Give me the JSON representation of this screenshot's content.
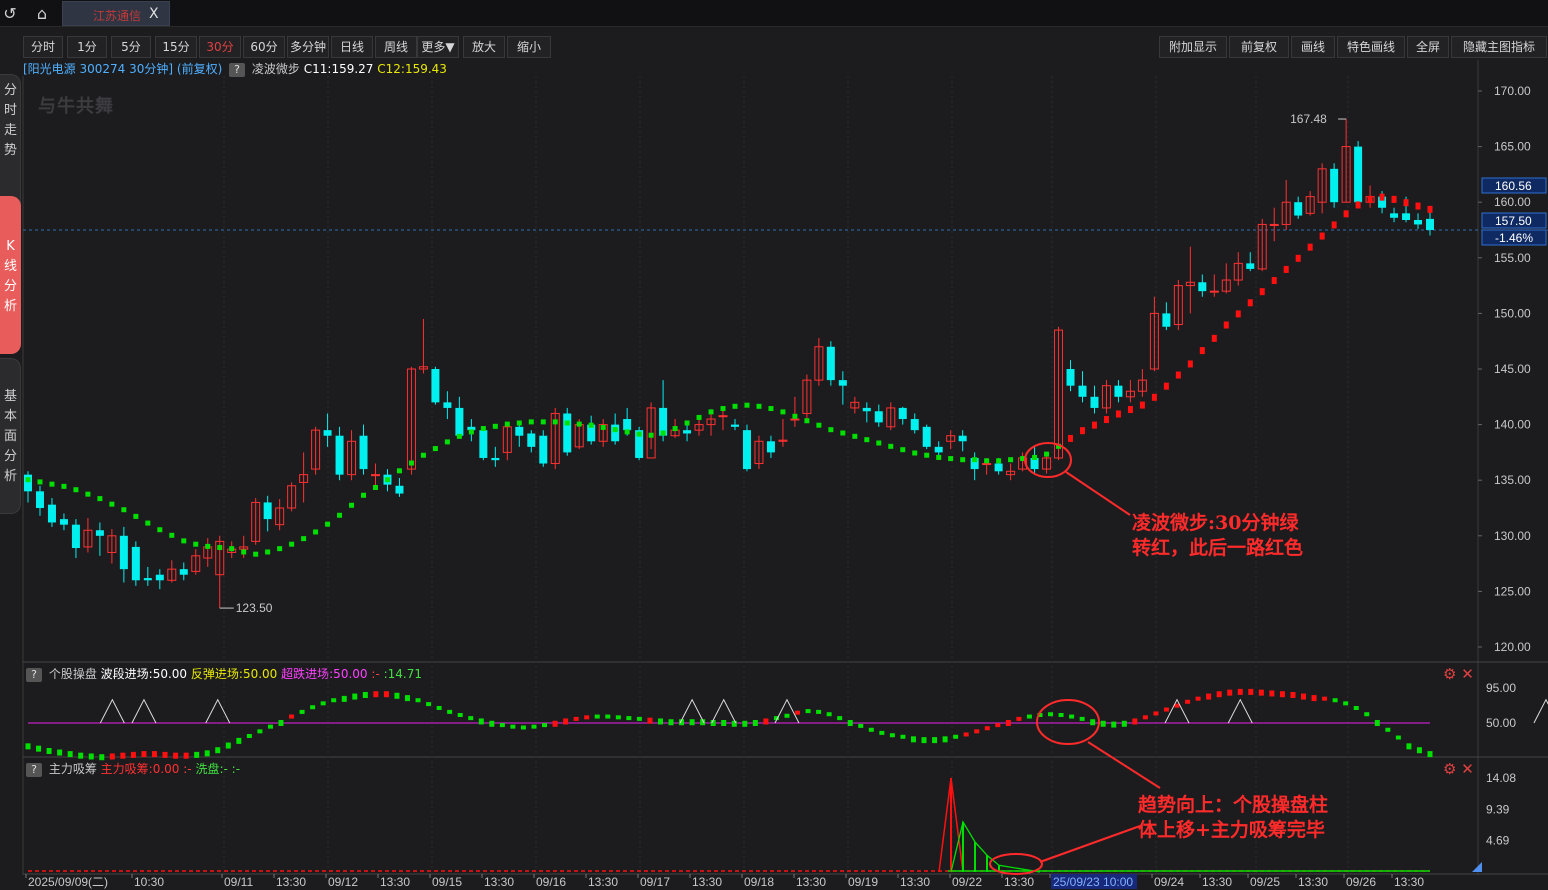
{
  "window": {
    "tab_title": "江苏通信",
    "close_glyph": "X",
    "icons": [
      "back-icon",
      "home-icon"
    ]
  },
  "side_tabs": [
    {
      "label": [
        "分",
        "时",
        "走",
        "势"
      ],
      "active": false
    },
    {
      "label": [
        "K",
        "线",
        "分",
        "析"
      ],
      "active": true
    },
    {
      "label": [
        "基",
        "本",
        "面",
        "分",
        "析"
      ],
      "active": false
    }
  ],
  "toolbar": {
    "left": [
      "分时",
      "1分",
      "5分",
      "15分",
      "30分",
      "60分",
      "多分钟",
      "日线",
      "周线",
      "更多▼",
      "放大",
      "缩小"
    ],
    "active": "30分",
    "right": [
      "附加显示",
      "前复权",
      "画线",
      "特色画线",
      "全屏",
      "隐藏主图指标"
    ]
  },
  "title_line": {
    "stock": "[阳光电源 300274 30分钟] (前复权)",
    "indicator": "凌波微步",
    "c11": "C11:159.27",
    "c12": "C12:159.43",
    "help": "?"
  },
  "watermark": "与牛共舞",
  "main_axis": {
    "ticks": [
      "170.00",
      "165.00",
      "160.00",
      "155.00",
      "150.00",
      "145.00",
      "140.00",
      "135.00",
      "130.00",
      "125.00",
      "120.00"
    ],
    "tag_upper": "160.56",
    "tag_price": "157.50",
    "tag_change": "-1.46%",
    "high_label": "167.48",
    "low_label": "123.50"
  },
  "annotations": {
    "a1_line1": "凌波微步:30分钟绿",
    "a1_line2": "转红，此后一路红色",
    "a2_line1": "趋势向上：个股操盘柱",
    "a2_line2": "体上移+主力吸筹完毕"
  },
  "ind1": {
    "name": "个股操盘",
    "p1": "波段进场:50.00",
    "p2": "反弹进场:50.00",
    "p3": "超跌进场:50.00",
    "p4": ":-",
    "p5": ":14.71",
    "ticks": [
      "95.00",
      "50.00"
    ],
    "help": "?"
  },
  "ind2": {
    "name": "主力吸筹",
    "p1": "主力吸筹:0.00",
    "p2": ":-",
    "p3": "洗盘:-",
    "p4": ":-",
    "ticks": [
      "14.08",
      "9.39",
      "4.69"
    ],
    "help": "?"
  },
  "x_axis": [
    "2025/09/09(二)",
    "10:30",
    "09/11",
    "13:30",
    "09/12",
    "13:30",
    "09/15",
    "13:30",
    "09/16",
    "13:30",
    "09/17",
    "13:30",
    "09/18",
    "13:30",
    "09/19",
    "13:30",
    "09/22",
    "13:30",
    "25/09/23 10:00",
    "09/24",
    "13:30",
    "09/25",
    "13:30",
    "09/26",
    "13:30"
  ],
  "colors": {
    "up": "#ff3030",
    "down": "#00f0f0",
    "dot_green": "#00e000",
    "dot_red": "#ff1010",
    "purple": "#c020c0",
    "annot": "#ff2a2a"
  },
  "chart_data": {
    "type": "candlestick",
    "price_ylim": [
      120,
      170
    ],
    "candles": [
      [
        135.5,
        134.0,
        135.8,
        133.0
      ],
      [
        134.0,
        132.5,
        134.5,
        131.8
      ],
      [
        132.8,
        131.2,
        133.4,
        130.8
      ],
      [
        131.5,
        131.0,
        132.0,
        130.5
      ],
      [
        131.0,
        128.9,
        131.5,
        128.0
      ],
      [
        129.0,
        130.5,
        131.6,
        128.5
      ],
      [
        130.5,
        130.0,
        131.2,
        128.2
      ],
      [
        128.5,
        130.0,
        130.6,
        127.5
      ],
      [
        130.0,
        127.0,
        130.8,
        125.8
      ],
      [
        129.0,
        126.0,
        129.5,
        125.5
      ],
      [
        126.2,
        126.0,
        127.2,
        125.5
      ],
      [
        126.5,
        126.0,
        127.0,
        125.2
      ],
      [
        126.0,
        127.0,
        127.8,
        125.8
      ],
      [
        127.0,
        126.5,
        127.6,
        126.0
      ],
      [
        126.8,
        128.2,
        128.8,
        126.5
      ],
      [
        128.0,
        129.0,
        129.8,
        127.2
      ],
      [
        126.5,
        129.5,
        130.0,
        123.5
      ],
      [
        128.5,
        128.8,
        129.5,
        128.0
      ],
      [
        128.8,
        129.0,
        130.0,
        128.0
      ],
      [
        129.5,
        133.0,
        133.4,
        129.2
      ],
      [
        133.0,
        131.5,
        133.6,
        130.4
      ],
      [
        131.0,
        132.5,
        133.3,
        130.5
      ],
      [
        132.5,
        134.5,
        134.8,
        132.2
      ],
      [
        134.8,
        135.5,
        137.5,
        133.0
      ],
      [
        136.0,
        139.5,
        139.8,
        135.5
      ],
      [
        139.5,
        139.0,
        141.0,
        138.0
      ],
      [
        139.0,
        135.5,
        139.8,
        135.0
      ],
      [
        135.5,
        138.5,
        139.5,
        135.0
      ],
      [
        139.0,
        136.0,
        140.0,
        135.5
      ],
      [
        135.5,
        135.5,
        136.5,
        134.5
      ],
      [
        135.5,
        134.6,
        136.0,
        134.0
      ],
      [
        134.5,
        133.8,
        135.2,
        133.5
      ],
      [
        136.0,
        145.0,
        145.2,
        135.5
      ],
      [
        145.0,
        145.2,
        149.5,
        144.6
      ],
      [
        145.0,
        142.0,
        145.2,
        141.8
      ],
      [
        142.0,
        141.5,
        143.0,
        140.5
      ],
      [
        141.5,
        139.0,
        142.5,
        138.8
      ],
      [
        139.8,
        139.5,
        140.5,
        138.5
      ],
      [
        139.5,
        137.0,
        139.8,
        136.8
      ],
      [
        137.0,
        136.8,
        138.0,
        136.2
      ],
      [
        137.5,
        139.8,
        140.0,
        136.8
      ],
      [
        139.8,
        139.0,
        140.2,
        138.0
      ],
      [
        139.2,
        138.0,
        139.5,
        137.5
      ],
      [
        139.0,
        136.5,
        139.5,
        136.2
      ],
      [
        136.5,
        141.0,
        141.5,
        136.0
      ],
      [
        141.0,
        137.5,
        141.5,
        137.2
      ],
      [
        138.0,
        140.0,
        140.5,
        137.8
      ],
      [
        140.0,
        138.5,
        140.8,
        138.2
      ],
      [
        138.5,
        140.0,
        140.5,
        138.0
      ],
      [
        140.0,
        138.5,
        141.0,
        138.2
      ],
      [
        140.5,
        139.5,
        141.5,
        139.0
      ],
      [
        139.5,
        137.0,
        139.8,
        136.8
      ],
      [
        137.0,
        141.5,
        142.0,
        137.8
      ],
      [
        141.5,
        139.0,
        144.0,
        138.5
      ],
      [
        139.0,
        139.5,
        140.5,
        138.8
      ],
      [
        139.5,
        139.2,
        140.0,
        138.5
      ],
      [
        139.5,
        140.0,
        140.5,
        139.0
      ],
      [
        140.0,
        140.5,
        141.2,
        139.0
      ],
      [
        140.8,
        140.8,
        141.5,
        139.5
      ],
      [
        140.0,
        139.8,
        140.5,
        139.5
      ],
      [
        139.5,
        136.0,
        140.0,
        135.8
      ],
      [
        136.5,
        138.5,
        139.0,
        136.0
      ],
      [
        138.5,
        137.5,
        139.0,
        137.0
      ],
      [
        138.5,
        138.6,
        140.5,
        138.0
      ],
      [
        140.5,
        140.5,
        142.5,
        139.8
      ],
      [
        141.0,
        144.0,
        144.5,
        140.5
      ],
      [
        144.0,
        147.0,
        147.8,
        143.5
      ],
      [
        147.0,
        144.0,
        147.5,
        143.5
      ],
      [
        144.0,
        143.5,
        144.8,
        141.8
      ],
      [
        141.5,
        142.0,
        142.5,
        141.0
      ],
      [
        141.5,
        141.2,
        142.0,
        140.2
      ],
      [
        141.2,
        140.2,
        141.8,
        139.8
      ],
      [
        139.8,
        141.5,
        142.0,
        139.5
      ],
      [
        141.5,
        140.5,
        141.6,
        140.0
      ],
      [
        140.5,
        139.5,
        141.0,
        139.2
      ],
      [
        139.8,
        138.0,
        140.0,
        137.8
      ],
      [
        138.0,
        137.5,
        138.5,
        137.0
      ],
      [
        138.5,
        139.0,
        139.5,
        137.8
      ],
      [
        139.0,
        138.5,
        139.5,
        137.6
      ],
      [
        137.0,
        136.0,
        137.5,
        135.0
      ],
      [
        136.5,
        136.5,
        137.0,
        135.5
      ],
      [
        136.5,
        135.8,
        137.0,
        135.5
      ],
      [
        135.5,
        135.8,
        136.5,
        135.0
      ],
      [
        136.0,
        137.0,
        137.5,
        135.8
      ],
      [
        137.0,
        136.0,
        138.0,
        135.6
      ],
      [
        136.0,
        137.0,
        137.5,
        135.6
      ],
      [
        137.0,
        148.5,
        148.8,
        136.8
      ],
      [
        145.0,
        143.5,
        145.8,
        143.0
      ],
      [
        143.5,
        142.5,
        144.8,
        142.0
      ],
      [
        142.5,
        141.5,
        143.5,
        141.0
      ],
      [
        141.5,
        143.5,
        144.0,
        141.0
      ],
      [
        143.5,
        142.5,
        144.0,
        142.0
      ],
      [
        142.5,
        143.0,
        144.0,
        142.0
      ],
      [
        143.0,
        144.0,
        145.0,
        142.5
      ],
      [
        145.0,
        150.0,
        151.5,
        144.8
      ],
      [
        150.0,
        148.8,
        151.0,
        148.5
      ],
      [
        149.0,
        152.5,
        153.0,
        148.5
      ],
      [
        152.5,
        152.8,
        156.0,
        150.0
      ],
      [
        152.8,
        152.0,
        153.5,
        151.5
      ],
      [
        152.0,
        152.0,
        153.5,
        151.5
      ],
      [
        152.0,
        153.0,
        154.5,
        151.8
      ],
      [
        153.0,
        154.5,
        155.5,
        152.5
      ],
      [
        154.5,
        154.0,
        155.5,
        153.8
      ],
      [
        154.0,
        158.0,
        158.5,
        153.8
      ],
      [
        158.0,
        158.0,
        159.5,
        156.5
      ],
      [
        158.0,
        160.0,
        162.0,
        157.5
      ],
      [
        160.0,
        158.8,
        160.5,
        158.5
      ],
      [
        159.0,
        160.5,
        161.0,
        158.8
      ],
      [
        160.0,
        163.0,
        163.5,
        159.0
      ],
      [
        163.0,
        160.0,
        163.5,
        159.5
      ],
      [
        160.0,
        165.0,
        167.5,
        160.0
      ],
      [
        165.0,
        160.0,
        165.5,
        159.5
      ],
      [
        160.0,
        160.5,
        161.5,
        159.5
      ],
      [
        160.5,
        159.5,
        161.0,
        159.0
      ],
      [
        159.0,
        158.6,
        159.5,
        158.2
      ],
      [
        159.0,
        158.4,
        160.5,
        158.2
      ],
      [
        158.4,
        158.0,
        159.0,
        157.6
      ],
      [
        158.5,
        157.5,
        159.6,
        157.0
      ]
    ],
    "lingbo_dots": {
      "values": [
        135.0,
        134.8,
        134.6,
        134.4,
        134.1,
        133.7,
        133.3,
        132.8,
        132.3,
        131.7,
        131.1,
        130.5,
        130.0,
        129.5,
        129.2,
        129.0,
        128.9,
        128.8,
        128.5,
        128.3,
        128.5,
        128.8,
        129.2,
        129.7,
        130.3,
        131.0,
        131.8,
        132.7,
        133.6,
        134.3,
        135.0,
        135.8,
        136.5,
        137.2,
        137.8,
        138.4,
        138.9,
        139.3,
        139.6,
        139.8,
        140.0,
        140.1,
        140.2,
        140.2,
        140.2,
        140.1,
        140.0,
        139.9,
        139.7,
        139.5,
        139.3,
        139.1,
        139.0,
        139.2,
        139.6,
        140.1,
        140.6,
        141.1,
        141.4,
        141.6,
        141.7,
        141.6,
        141.4,
        141.1,
        140.7,
        140.3,
        139.9,
        139.5,
        139.2,
        138.9,
        138.6,
        138.3,
        138.0,
        137.7,
        137.4,
        137.2,
        137.0,
        136.9,
        136.8,
        136.8,
        136.7,
        136.7,
        136.8,
        136.9,
        137.0,
        137.3,
        138.0,
        138.8,
        139.5,
        140.0,
        140.5,
        141.0,
        141.4,
        141.8,
        142.5,
        143.5,
        144.5,
        145.5,
        146.7,
        147.8,
        149.0,
        150.0,
        151.0,
        152.0,
        153.0,
        154.0,
        155.0,
        156.0,
        157.0,
        158.0,
        159.0,
        159.8,
        160.3,
        160.5,
        160.3,
        160.0,
        159.7,
        159.4
      ],
      "green_until_index": 86
    },
    "ind1_bars": {
      "ylim": [
        0,
        100
      ],
      "base": 50,
      "values": [
        20,
        17,
        14,
        12,
        10,
        8,
        7,
        6,
        7,
        8,
        9,
        10,
        10,
        9,
        8,
        8,
        9,
        11,
        15,
        21,
        27,
        32,
        38,
        44,
        50,
        57,
        63,
        69,
        74,
        78,
        81,
        84,
        86,
        87,
        87,
        85,
        82,
        78,
        73,
        68,
        63,
        59,
        55,
        52,
        49,
        46,
        44,
        43,
        44,
        46,
        49,
        52,
        54,
        56,
        57,
        57,
        56,
        55,
        54,
        53,
        52,
        51,
        51,
        51,
        51,
        50,
        50,
        49,
        49,
        50,
        52,
        55,
        58,
        62,
        64,
        63,
        60,
        55,
        50,
        45,
        40,
        36,
        33,
        31,
        29,
        28,
        28,
        29,
        31,
        34,
        38,
        42,
        46,
        50,
        54,
        57,
        59,
        60,
        59,
        57,
        54,
        51,
        49,
        48,
        49,
        52,
        56,
        61,
        66,
        71,
        76,
        80,
        84,
        87,
        89,
        90,
        90,
        89,
        88,
        87,
        86,
        84,
        82,
        80,
        78,
        74,
        68,
        60,
        50,
        40,
        30,
        20,
        15,
        10
      ],
      "green_index": [
        0,
        1,
        2,
        3,
        4,
        5,
        6,
        7,
        16,
        17,
        18,
        19,
        20,
        21,
        22,
        23,
        24,
        26,
        27,
        28,
        29,
        30,
        31,
        32,
        35,
        36,
        37,
        38,
        39,
        40,
        41,
        42,
        43,
        44,
        45,
        46,
        47,
        48,
        49,
        54,
        55,
        56,
        57,
        58,
        60,
        61,
        62,
        63,
        64,
        65,
        66,
        67,
        68,
        69,
        71,
        72,
        74,
        75,
        76,
        77,
        78,
        79,
        80,
        81,
        82,
        83,
        84,
        85,
        86,
        87,
        88,
        95,
        96,
        97,
        98,
        99,
        100,
        101,
        102,
        103,
        104,
        124,
        125,
        126,
        127,
        128,
        129,
        130,
        131,
        132,
        133
      ],
      "triangle_index": [
        8,
        11,
        18,
        63,
        66,
        72,
        109,
        115,
        144,
        150
      ]
    },
    "ind2_bars": {
      "ylim": [
        0,
        16
      ],
      "ticks": [
        4.69,
        9.39,
        14.08
      ],
      "spike_red_x": 951,
      "spike_red_value": 14.08,
      "green_spikes": [
        [
          963,
          7.5
        ],
        [
          975,
          4.5
        ],
        [
          987,
          2.5
        ],
        [
          999,
          1.0
        ]
      ]
    }
  }
}
